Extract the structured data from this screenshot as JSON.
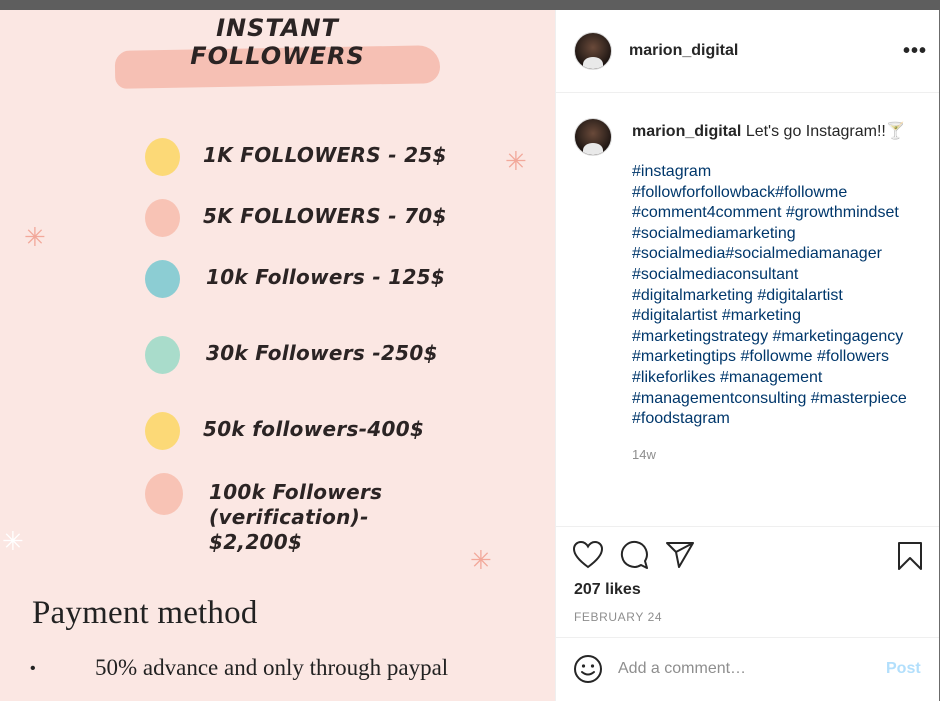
{
  "image": {
    "title_line1": "INSTANT",
    "title_line2": "FOLLOWERS",
    "tiers": [
      {
        "label": "1K FOLLOWERS - 25$",
        "color": "#fcd977"
      },
      {
        "label": "5K FOLLOWERS - 70$",
        "color": "#f8c3b5"
      },
      {
        "label": "10k Followers - 125$",
        "color": "#8ccdd3"
      },
      {
        "label": "30k Followers -250$",
        "color": "#a9dccb"
      },
      {
        "label": "50k followers-400$",
        "color": "#fcd977"
      },
      {
        "label_lines": [
          "100k Followers",
          "(verification)-",
          "$2,200$"
        ],
        "color": "#f8c3b5"
      }
    ],
    "payment_title": "Payment method",
    "payment_bullet": "•",
    "payment_text": "50% advance and only through paypal"
  },
  "post": {
    "username": "marion_digital",
    "more_icon": "more-horizontal-icon",
    "caption_text": "Let's go Instagram!!🍸",
    "hashtag_lines": [
      "#instagram",
      "#followforfollowback#followme",
      "#comment4comment #growthmindset",
      "#socialmediamarketing",
      "#socialmedia#socialmediamanager",
      "#socialmediaconsultant",
      "#digitalmarketing #digitalartist",
      "#digitalartist #marketing",
      "#marketingstrategy #marketingagency",
      "#marketingtips #followme #followers",
      "#likeforlikes #management",
      "#managementconsulting #masterpiece",
      "#foodstagram"
    ],
    "time_ago": "14w",
    "likes": "207 likes",
    "date": "FEBRUARY 24",
    "comment_placeholder": "Add a comment…",
    "post_label": "Post"
  },
  "icons": [
    "heart-icon",
    "comment-icon",
    "share-icon",
    "bookmark-icon",
    "emoji-icon"
  ]
}
